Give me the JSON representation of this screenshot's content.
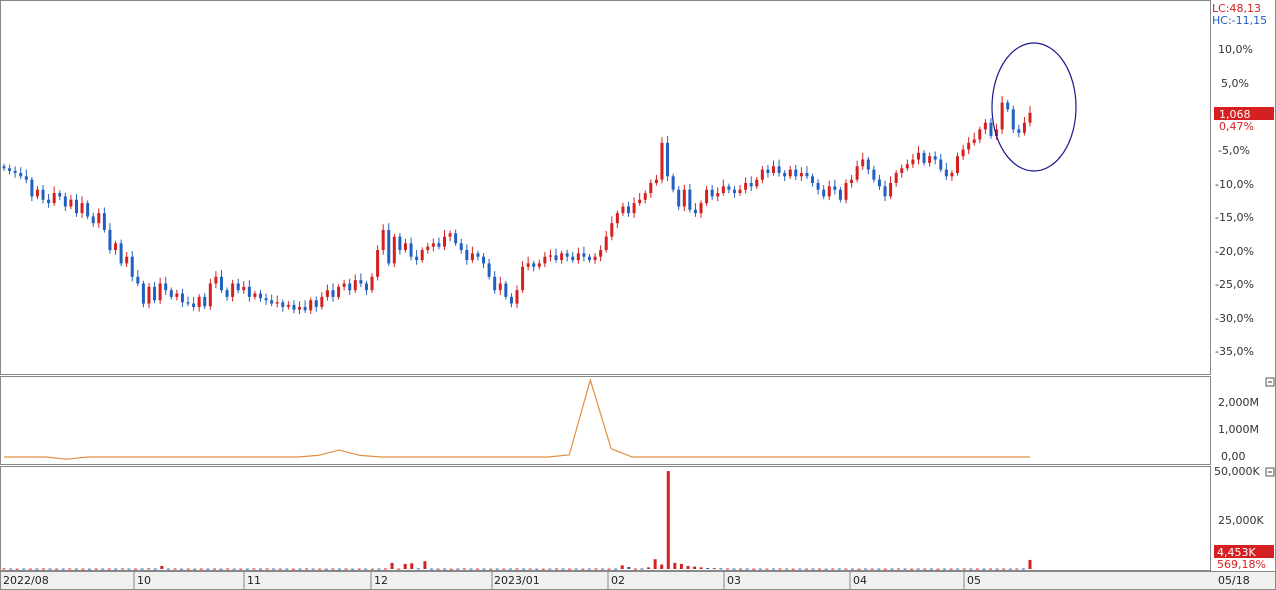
{
  "info": {
    "lc_text": "LC:48,13",
    "hc_text": "HC:-11,15"
  },
  "price_panel": {
    "ytick_labels": [
      "10,0%",
      "5,0%",
      "-5,0%",
      "-10,0%",
      "-15,0%",
      "-20,0%",
      "-25,0%",
      "-30,0%",
      "-35,0%"
    ],
    "current_price_label": "1,068",
    "current_pct_label": "0,47%"
  },
  "indicator_panel": {
    "ytick_labels": [
      "2,000M",
      "1,000M",
      "0,00"
    ]
  },
  "volume_panel": {
    "ytick_labels": [
      "50,000K",
      "25,000K"
    ],
    "current_volume_label": "4,453K",
    "volume_pct_label": "569,18%"
  },
  "x_axis": {
    "month_labels": [
      "2022/08",
      "10",
      "11",
      "12",
      "2023/01",
      "02",
      "03",
      "04",
      "05"
    ],
    "end_label": "05/18"
  },
  "colors": {
    "up": "#d42020",
    "down": "#2060c0",
    "indicator_line": "#e09040",
    "annotation_circle": "#1a1a8c",
    "price_badge_bg": "#d42020"
  },
  "chart_data": {
    "type": "candlestick",
    "title": "",
    "panels": [
      "price_percent",
      "trading_value",
      "volume"
    ],
    "x_start": "2022/08",
    "x_end": "05/18",
    "price_ylim": [
      -40,
      15
    ],
    "price_unit": "% change",
    "current_change_pct": 0.47,
    "current_price": 1068,
    "close_pct": [
      -7.8,
      -8.2,
      -8.5,
      -9.0,
      -9.5,
      -12,
      -11,
      -12.5,
      -13,
      -11.5,
      -12,
      -13.5,
      -12.5,
      -14.5,
      -13,
      -15,
      -16,
      -14.5,
      -17,
      -20,
      -19,
      -22,
      -21,
      -24,
      -25,
      -28,
      -25.5,
      -27.5,
      -25,
      -26,
      -27,
      -26.5,
      -27.8,
      -28,
      -28.5,
      -27,
      -28.4,
      -25,
      -24,
      -26,
      -27,
      -25,
      -26,
      -25.5,
      -27,
      -26.5,
      -27.2,
      -27.5,
      -28,
      -27.8,
      -28.5,
      -28.2,
      -28.9,
      -28.5,
      -29,
      -27.5,
      -28.5,
      -27,
      -26,
      -27,
      -25.5,
      -25,
      -26,
      -24.5,
      -25,
      -26,
      -24,
      -20,
      -17,
      -22,
      -18,
      -20,
      -19,
      -21,
      -21.5,
      -20,
      -19.5,
      -19,
      -19.5,
      -18,
      -17.5,
      -19,
      -20,
      -21.5,
      -20.5,
      -21,
      -22,
      -24,
      -26,
      -25,
      -27,
      -28,
      -26,
      -22.5,
      -22,
      -22.5,
      -22,
      -21,
      -20.8,
      -21.5,
      -20.5,
      -21,
      -21.5,
      -20.5,
      -21,
      -21.5,
      -21,
      -20,
      -18,
      -16,
      -14.5,
      -13.5,
      -14.5,
      -13,
      -12.5,
      -11.5,
      -10,
      -9.5,
      -4,
      -9,
      -11,
      -13.5,
      -11,
      -14,
      -14.5,
      -13,
      -11,
      -12,
      -11.5,
      -10.5,
      -11,
      -11.5,
      -11,
      -10,
      -10.5,
      -9.5,
      -8,
      -8.5,
      -7.5,
      -8.5,
      -9,
      -8,
      -9,
      -8.5,
      -9,
      -10,
      -11,
      -12,
      -10.5,
      -11,
      -12.5,
      -10,
      -9.5,
      -7.5,
      -6.5,
      -8,
      -9.5,
      -10.5,
      -12,
      -10,
      -8.5,
      -7.8,
      -7.2,
      -6.5,
      -5.5,
      -7,
      -6,
      -6.5,
      -8,
      -9,
      -8.5,
      -6,
      -5,
      -4,
      -3.5,
      -2,
      -1,
      -3,
      -2,
      2,
      1,
      -2,
      -2.5,
      -1,
      0.47
    ],
    "volume_K": [
      300,
      200,
      150,
      200,
      180,
      200,
      250,
      200,
      180,
      200,
      220,
      200,
      180,
      150,
      200,
      180,
      200,
      200,
      250,
      200,
      180,
      200,
      300,
      200,
      1500,
      200,
      250,
      150,
      200,
      150,
      200,
      180,
      200,
      150,
      220,
      180,
      200,
      150,
      250,
      200,
      220,
      200,
      180,
      200,
      150,
      200,
      250,
      200,
      180,
      150,
      200,
      180,
      200,
      150,
      200,
      180,
      150,
      200,
      250,
      3000,
      200,
      2500,
      2800,
      300,
      3800,
      200,
      180,
      200,
      150,
      200,
      250,
      200,
      180,
      200,
      150,
      200,
      180,
      200,
      250,
      200,
      200,
      180,
      150,
      200,
      250,
      200,
      180,
      200,
      150,
      200,
      250,
      200,
      180,
      200,
      1800,
      1000,
      200,
      250,
      800,
      4800,
      2200,
      48000,
      3000,
      2500,
      1500,
      1200,
      800,
      500,
      400,
      300,
      250,
      200,
      180,
      200,
      150,
      200,
      180,
      200,
      250,
      200,
      150,
      200,
      180,
      200,
      180,
      150,
      200,
      250,
      200,
      180,
      150,
      200,
      180,
      200,
      180,
      200,
      250,
      200,
      150,
      200,
      180,
      200,
      150,
      200,
      180,
      200,
      250,
      200,
      180,
      150,
      200,
      180,
      200,
      180,
      200,
      250,
      4453
    ],
    "indicator_M": [
      0,
      0,
      0,
      -80,
      0,
      0,
      0,
      0,
      0,
      0,
      0,
      0,
      0,
      0,
      0,
      60,
      250,
      60,
      0,
      0,
      0,
      0,
      0,
      0,
      0,
      0,
      0,
      80,
      2800,
      300,
      0,
      0,
      0,
      0,
      0,
      0,
      0,
      0,
      0,
      0,
      0,
      0,
      0,
      0,
      0,
      0,
      0,
      0,
      0,
      0
    ]
  }
}
